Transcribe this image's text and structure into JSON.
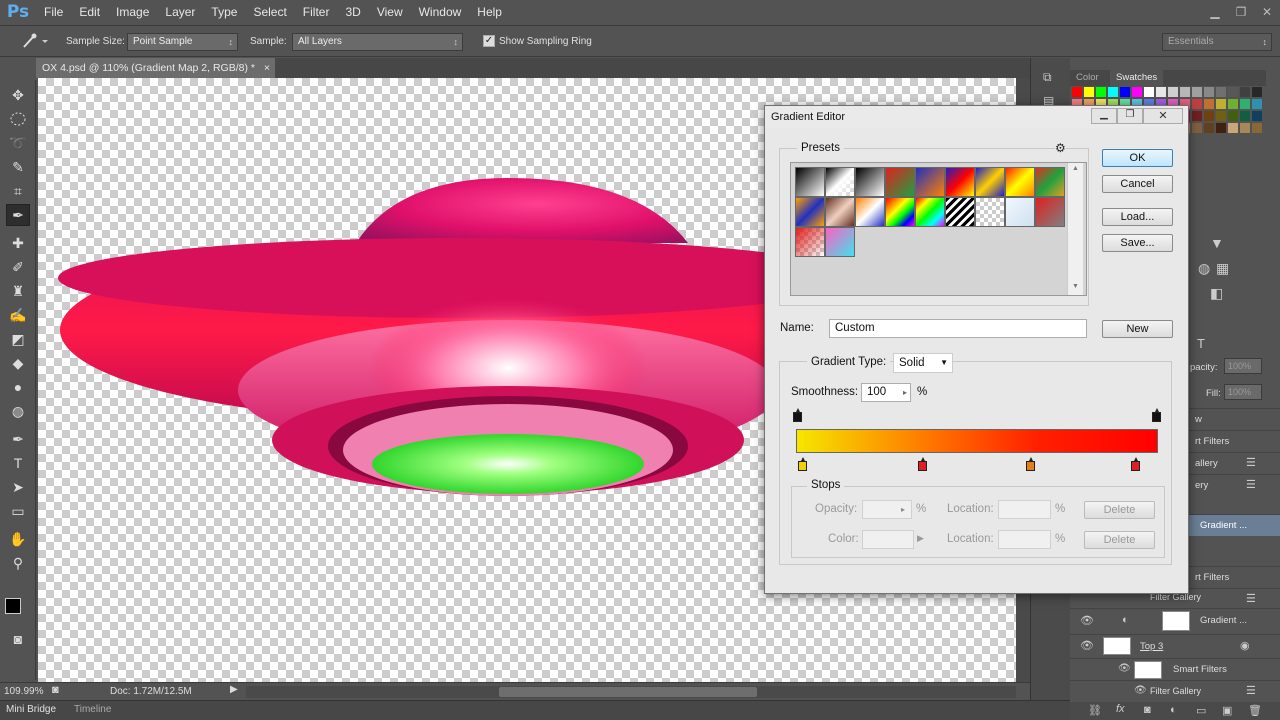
{
  "app": {
    "logo": "Ps"
  },
  "menu": [
    "File",
    "Edit",
    "Image",
    "Layer",
    "Type",
    "Select",
    "Filter",
    "3D",
    "View",
    "Window",
    "Help"
  ],
  "window_controls": {
    "minimize": "▁",
    "restore": "❐",
    "close": "✕"
  },
  "options_bar": {
    "tool_icon": "eyedropper-icon",
    "sample_size_label": "Sample Size:",
    "sample_size_value": "Point Sample",
    "sample_label": "Sample:",
    "sample_value": "All Layers",
    "show_sampling_ring_label": "Show Sampling Ring",
    "show_sampling_ring_checked": true,
    "workspace_value": "Essentials"
  },
  "document": {
    "tab_title": "OX 4.psd @ 110% (Gradient Map 2, RGB/8) *",
    "tab_close": "×"
  },
  "status": {
    "zoom": "109.99%",
    "doc": "Doc: 1.72M/12.5M"
  },
  "bottom_tabs": [
    "Mini Bridge",
    "Timeline"
  ],
  "panels": {
    "color_tab": "Color",
    "swatches_tab": "Swatches",
    "opacity_label": "pacity:",
    "opacity_value": "100%",
    "fill_label": "Fill:",
    "fill_value": "100%",
    "layers": [
      {
        "text": "w"
      },
      {
        "text": "rt Filters"
      },
      {
        "text": "allery"
      },
      {
        "text": "ery"
      },
      {
        "text": "Gradient ..."
      },
      {
        "text": "rt Filters"
      },
      {
        "text": "Filter Gallery"
      },
      {
        "text": "Gradient ..."
      },
      {
        "text": "Top 3"
      },
      {
        "text": "Smart Filters"
      },
      {
        "text": "Filter Gallery"
      }
    ]
  },
  "gradient_editor": {
    "title": "Gradient Editor",
    "presets_label": "Presets",
    "ok": "OK",
    "cancel": "Cancel",
    "load": "Load...",
    "save": "Save...",
    "name_label": "Name:",
    "name_value": "Custom",
    "new_button": "New",
    "gradient_type_label": "Gradient Type:",
    "gradient_type_value": "Solid",
    "smoothness_label": "Smoothness:",
    "smoothness_value": "100",
    "smoothness_unit": "%",
    "stops_label": "Stops",
    "opacity_label": "Opacity:",
    "color_label": "Color:",
    "location_label": "Location:",
    "percent": "%",
    "delete": "Delete",
    "gradient_colors": [
      "#f5e600",
      "#ff8000",
      "#ff2000",
      "#ff0000"
    ],
    "color_stops": [
      {
        "color": "#f5d000",
        "location": 0.02
      },
      {
        "color": "#e02020",
        "location": 0.35
      },
      {
        "color": "#e08020",
        "location": 0.65
      },
      {
        "color": "#e02020",
        "location": 0.94
      }
    ]
  }
}
